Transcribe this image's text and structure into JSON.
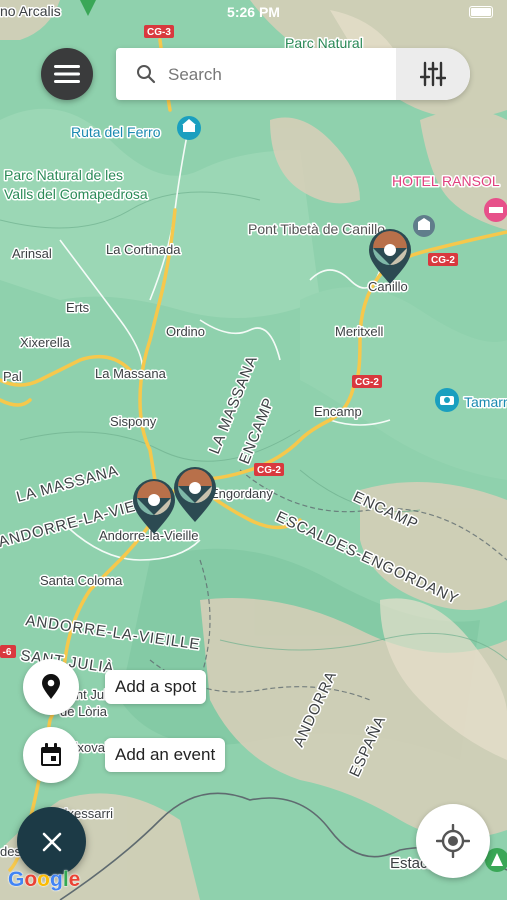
{
  "status_bar": {
    "time": "5:26 PM"
  },
  "search": {
    "placeholder": "Search"
  },
  "actions": {
    "add_spot": "Add a spot",
    "add_event": "Add an event"
  },
  "attribution": {
    "letters": [
      "G",
      "o",
      "o",
      "g",
      "l",
      "e"
    ]
  },
  "colors": {
    "fab_dark": "#1c3a46",
    "menu_dark": "#3a3b3c",
    "road": "#f6c84c",
    "road_label": "#d9383e"
  },
  "map": {
    "road_labels": [
      "CG-3",
      "CG-2",
      "CG-2",
      "CG-2",
      "CG-2",
      "-6"
    ],
    "places": {
      "parc_natural_top": "Parc Natural",
      "ruta_ferro": "Ruta del Ferro",
      "parc_valls_1": "Parc Natural de les",
      "parc_valls_2": "Valls del Comapedrosa",
      "hotel": "HOTEL RANSOL",
      "pont": "Pont Tibetà de Canillo",
      "la_cortinada": "La Cortinada",
      "arinsal": "Arinsal",
      "canillo": "Canillo",
      "erts": "Erts",
      "ordino": "Ordino",
      "xixerella": "Xixerella",
      "meritxell": "Meritxell",
      "pal": "Pal",
      "la_massana": "La Massana",
      "tamarro": "Tamarr",
      "sispony": "Sispony",
      "encamp_town": "Encamp",
      "engordany": "Engordany",
      "andorra_vieille": "Andorre-la-Vieille",
      "santa_coloma": "Santa Coloma",
      "julia": "Sant Julià",
      "loria": "de Lòria",
      "aixovall": "Aixovall",
      "estacio": "Estació d",
      "top_left_cut": "no Arcalis",
      "bottom_left": "Bixessarri",
      "left_des": "des"
    },
    "regions": {
      "la_massana_diag": "LA MASSANA",
      "encamp_diag": "ENCAMP",
      "la_massana": "LA MASSANA",
      "andorre_1": "ANDORRE-LA-VIEILLE",
      "escaldes": "ESCALDES-ENGORDANY",
      "encamp_right": "ENCAMP",
      "andorre_2": "ANDORRE-LA-VIEILLE",
      "sant_julia": "SANT JULIÀ",
      "andorra": "ANDORRA",
      "espana": "ESPAÑA"
    }
  }
}
